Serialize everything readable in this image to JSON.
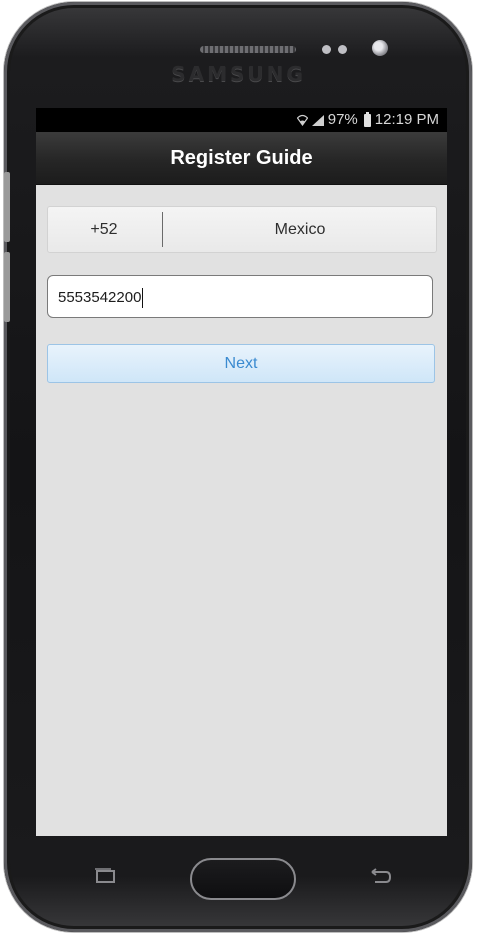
{
  "device": {
    "brand": "SAMSUNG"
  },
  "status_bar": {
    "battery": "97%",
    "time": "12:19 PM"
  },
  "header": {
    "title": "Register Guide"
  },
  "country_selector": {
    "code": "+52",
    "country": "Mexico"
  },
  "phone_field": {
    "value": "5553542200"
  },
  "actions": {
    "next_label": "Next"
  }
}
